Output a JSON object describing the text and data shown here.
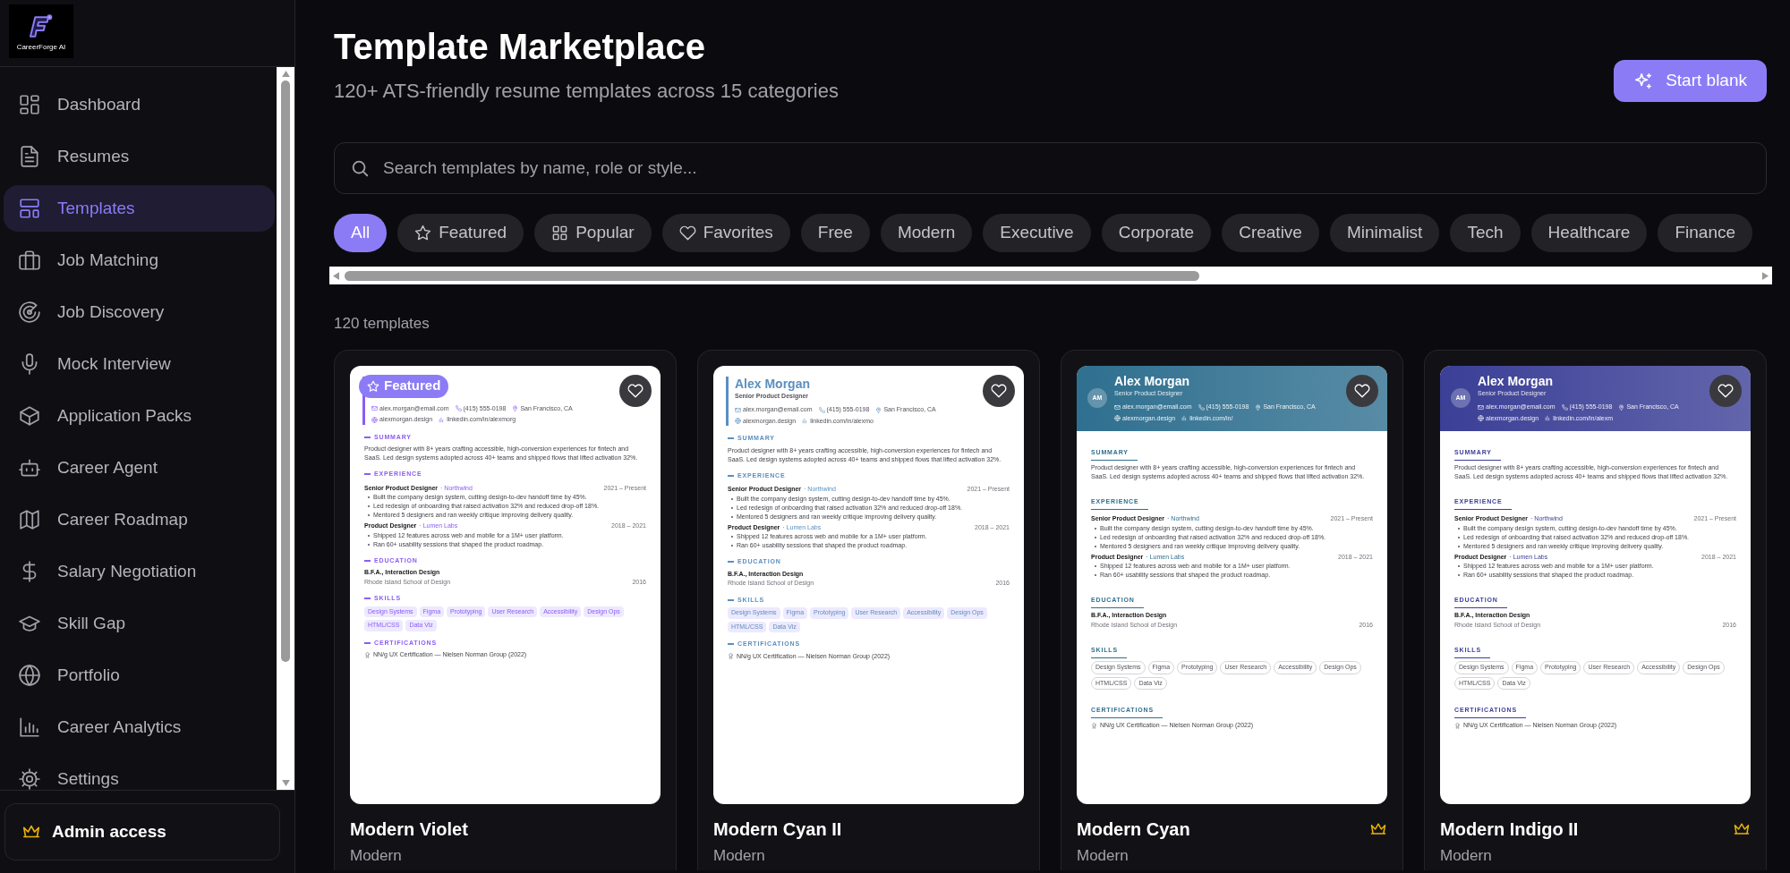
{
  "sidebar": {
    "logo_text": "CareerForge AI",
    "items": [
      {
        "label": "Dashboard",
        "selected": false
      },
      {
        "label": "Resumes",
        "selected": false
      },
      {
        "label": "Templates",
        "selected": true
      },
      {
        "label": "Job Matching",
        "selected": false
      },
      {
        "label": "Job Discovery",
        "selected": false
      },
      {
        "label": "Mock Interview",
        "selected": false
      },
      {
        "label": "Application Packs",
        "selected": false
      },
      {
        "label": "Career Agent",
        "selected": false
      },
      {
        "label": "Career Roadmap",
        "selected": false
      },
      {
        "label": "Salary Negotiation",
        "selected": false
      },
      {
        "label": "Skill Gap",
        "selected": false
      },
      {
        "label": "Portfolio",
        "selected": false
      },
      {
        "label": "Career Analytics",
        "selected": false
      },
      {
        "label": "Settings",
        "selected": false
      }
    ],
    "footer_button": "Admin access"
  },
  "header": {
    "title": "Template Marketplace",
    "subtitle": "120+ ATS-friendly resume templates across 15 categories",
    "action_button": "Start blank"
  },
  "search": {
    "placeholder": "Search templates by name, role or style..."
  },
  "filters": [
    {
      "label": "All",
      "selected": true
    },
    {
      "label": "Featured",
      "selected": false
    },
    {
      "label": "Popular",
      "selected": false
    },
    {
      "label": "Favorites",
      "selected": false
    },
    {
      "label": "Free",
      "selected": false
    },
    {
      "label": "Modern",
      "selected": false
    },
    {
      "label": "Executive",
      "selected": false
    },
    {
      "label": "Corporate",
      "selected": false
    },
    {
      "label": "Creative",
      "selected": false
    },
    {
      "label": "Minimalist",
      "selected": false
    },
    {
      "label": "Tech",
      "selected": false
    },
    {
      "label": "Healthcare",
      "selected": false
    },
    {
      "label": "Finance",
      "selected": false
    }
  ],
  "count": "120 templates",
  "cards": [
    {
      "name": "Modern Violet",
      "category": "Modern",
      "premium": false,
      "badge": "Featured",
      "favorited": false,
      "preview": {
        "kind": "accent-bar",
        "color": "#8b5cf6",
        "contacts": [
          "alex.morgan@email.com",
          "(415) 555-0198",
          "San Francisco, CA",
          "alexmorgan.design",
          "linkedin.com/in/alexmorg"
        ],
        "summary_heading": "SUMMARY",
        "summary": "Product designer with 8+ years crafting accessible, high-conversion experiences for fintech and SaaS. Led design systems adopted across 40+ teams and shipped flows that lifted activation 32%.",
        "experience_heading": "EXPERIENCE",
        "jobs": [
          {
            "role": "Senior Product Designer",
            "company": "· Northwind",
            "dates": "2021 – Present",
            "bullets": [
              "Built the company design system, cutting design-to-dev handoff time by 45%.",
              "Led redesign of onboarding that raised activation 32% and reduced drop-off 18%.",
              "Mentored 5 designers and ran weekly critique improving delivery quality."
            ]
          },
          {
            "role": "Product Designer",
            "company": "· Lumen Labs",
            "dates": "2018 – 2021",
            "bullets": [
              "Shipped 12 features across web and mobile for a 1M+ user platform.",
              "Ran 60+ usability sessions that shaped the product roadmap."
            ]
          }
        ],
        "education_heading": "EDUCATION",
        "degree": "B.F.A., Interaction Design",
        "school": "Rhode Island School of Design",
        "year": "2016",
        "skills_heading": "SKILLS",
        "skills": [
          "Design Systems",
          "Figma",
          "Prototyping",
          "User Research",
          "Accessibility",
          "Design Ops",
          "HTML/CSS",
          "Data Viz"
        ],
        "certifications_heading": "CERTIFICATIONS",
        "certification": "NN/g UX Certification — Nielsen Norman Group (2022)"
      }
    },
    {
      "name": "Modern Cyan II",
      "category": "Modern",
      "premium": false,
      "favorited": false,
      "preview": {
        "kind": "accent-bar",
        "color": "#5b8fbf",
        "name": "Alex Morgan",
        "title": "Senior Product Designer",
        "contacts": [
          "alex.morgan@email.com",
          "(415) 555-0198",
          "San Francisco, CA",
          "alexmorgan.design",
          "linkedin.com/in/alexmo"
        ],
        "summary_heading": "SUMMARY",
        "summary": "Product designer with 8+ years crafting accessible, high-conversion experiences for fintech and SaaS. Led design systems adopted across 40+ teams and shipped flows that lifted activation 32%.",
        "experience_heading": "EXPERIENCE",
        "jobs": [
          {
            "role": "Senior Product Designer",
            "company": "· Northwind",
            "dates": "2021 – Present",
            "bullets": [
              "Built the company design system, cutting design-to-dev handoff time by 45%.",
              "Led redesign of onboarding that raised activation 32% and reduced drop-off 18%.",
              "Mentored 5 designers and ran weekly critique improving delivery quality."
            ]
          },
          {
            "role": "Product Designer",
            "company": "· Lumen Labs",
            "dates": "2018 – 2021",
            "bullets": [
              "Shipped 12 features across web and mobile for a 1M+ user platform.",
              "Ran 60+ usability sessions that shaped the product roadmap."
            ]
          }
        ],
        "education_heading": "EDUCATION",
        "degree": "B.F.A., Interaction Design",
        "school": "Rhode Island School of Design",
        "year": "2016",
        "skills_heading": "SKILLS",
        "skills": [
          "Design Systems",
          "Figma",
          "Prototyping",
          "User Research",
          "Accessibility",
          "Design Ops",
          "HTML/CSS",
          "Data Viz"
        ],
        "certifications_heading": "CERTIFICATIONS",
        "certification": "NN/g UX Certification — Nielsen Norman Group (2022)"
      }
    },
    {
      "name": "Modern Cyan",
      "category": "Modern",
      "premium": true,
      "favorited": false,
      "preview": {
        "kind": "banner",
        "color": "#2f6f8f",
        "initials": "AM",
        "name": "Alex Morgan",
        "title": "Senior Product Designer",
        "contacts": [
          "alex.morgan@email.com",
          "(415) 555-0198",
          "San Francisco, CA",
          "alexmorgan.design",
          "linkedin.com/in/"
        ],
        "summary_heading": "SUMMARY",
        "summary": "Product designer with 8+ years crafting accessible, high-conversion experiences for fintech and SaaS. Led design systems adopted across 40+ teams and shipped flows that lifted activation 32%.",
        "experience_heading": "EXPERIENCE",
        "jobs": [
          {
            "role": "Senior Product Designer",
            "company": "· Northwind",
            "dates": "2021 – Present",
            "bullets": [
              "Built the company design system, cutting design-to-dev handoff time by 45%.",
              "Led redesign of onboarding that raised activation 32% and reduced drop-off 18%.",
              "Mentored 5 designers and ran weekly critique improving delivery quality."
            ]
          },
          {
            "role": "Product Designer",
            "company": "· Lumen Labs",
            "dates": "2018 – 2021",
            "bullets": [
              "Shipped 12 features across web and mobile for a 1M+ user platform.",
              "Ran 60+ usability sessions that shaped the product roadmap."
            ]
          }
        ],
        "education_heading": "EDUCATION",
        "degree": "B.F.A., Interaction Design",
        "school": "Rhode Island School of Design",
        "year": "2016",
        "skills_heading": "SKILLS",
        "skills": [
          "Design Systems",
          "Figma",
          "Prototyping",
          "User Research",
          "Accessibility",
          "Design Ops",
          "HTML/CSS",
          "Data Viz"
        ],
        "certifications_heading": "CERTIFICATIONS",
        "certification": "NN/g UX Certification — Nielsen Norman Group (2022)"
      }
    },
    {
      "name": "Modern Indigo II",
      "category": "Modern",
      "premium": true,
      "favorited": false,
      "preview": {
        "kind": "banner",
        "color": "#3b3f96",
        "initials": "AM",
        "name": "Alex Morgan",
        "title": "Senior Product Designer",
        "contacts": [
          "alex.morgan@email.com",
          "(415) 555-0198",
          "San Francisco, CA",
          "alexmorgan.design",
          "linkedin.com/in/alexm"
        ],
        "summary_heading": "SUMMARY",
        "summary": "Product designer with 8+ years crafting accessible, high-conversion experiences for fintech and SaaS. Led design systems adopted across 40+ teams and shipped flows that lifted activation 32%.",
        "experience_heading": "EXPERIENCE",
        "jobs": [
          {
            "role": "Senior Product Designer",
            "company": "· Northwind",
            "dates": "2021 – Present",
            "bullets": [
              "Built the company design system, cutting design-to-dev handoff time by 45%.",
              "Led redesign of onboarding that raised activation 32% and reduced drop-off 18%.",
              "Mentored 5 designers and ran weekly critique improving delivery quality."
            ]
          },
          {
            "role": "Product Designer",
            "company": "· Lumen Labs",
            "dates": "2018 – 2021",
            "bullets": [
              "Shipped 12 features across web and mobile for a 1M+ user platform.",
              "Ran 60+ usability sessions that shaped the product roadmap."
            ]
          }
        ],
        "education_heading": "EDUCATION",
        "degree": "B.F.A., Interaction Design",
        "school": "Rhode Island School of Design",
        "year": "2016",
        "skills_heading": "SKILLS",
        "skills": [
          "Design Systems",
          "Figma",
          "Prototyping",
          "User Research",
          "Accessibility",
          "Design Ops",
          "HTML/CSS",
          "Data Viz"
        ],
        "certifications_heading": "CERTIFICATIONS",
        "certification": "NN/g UX Certification — Nielsen Norman Group (2022)"
      }
    }
  ]
}
